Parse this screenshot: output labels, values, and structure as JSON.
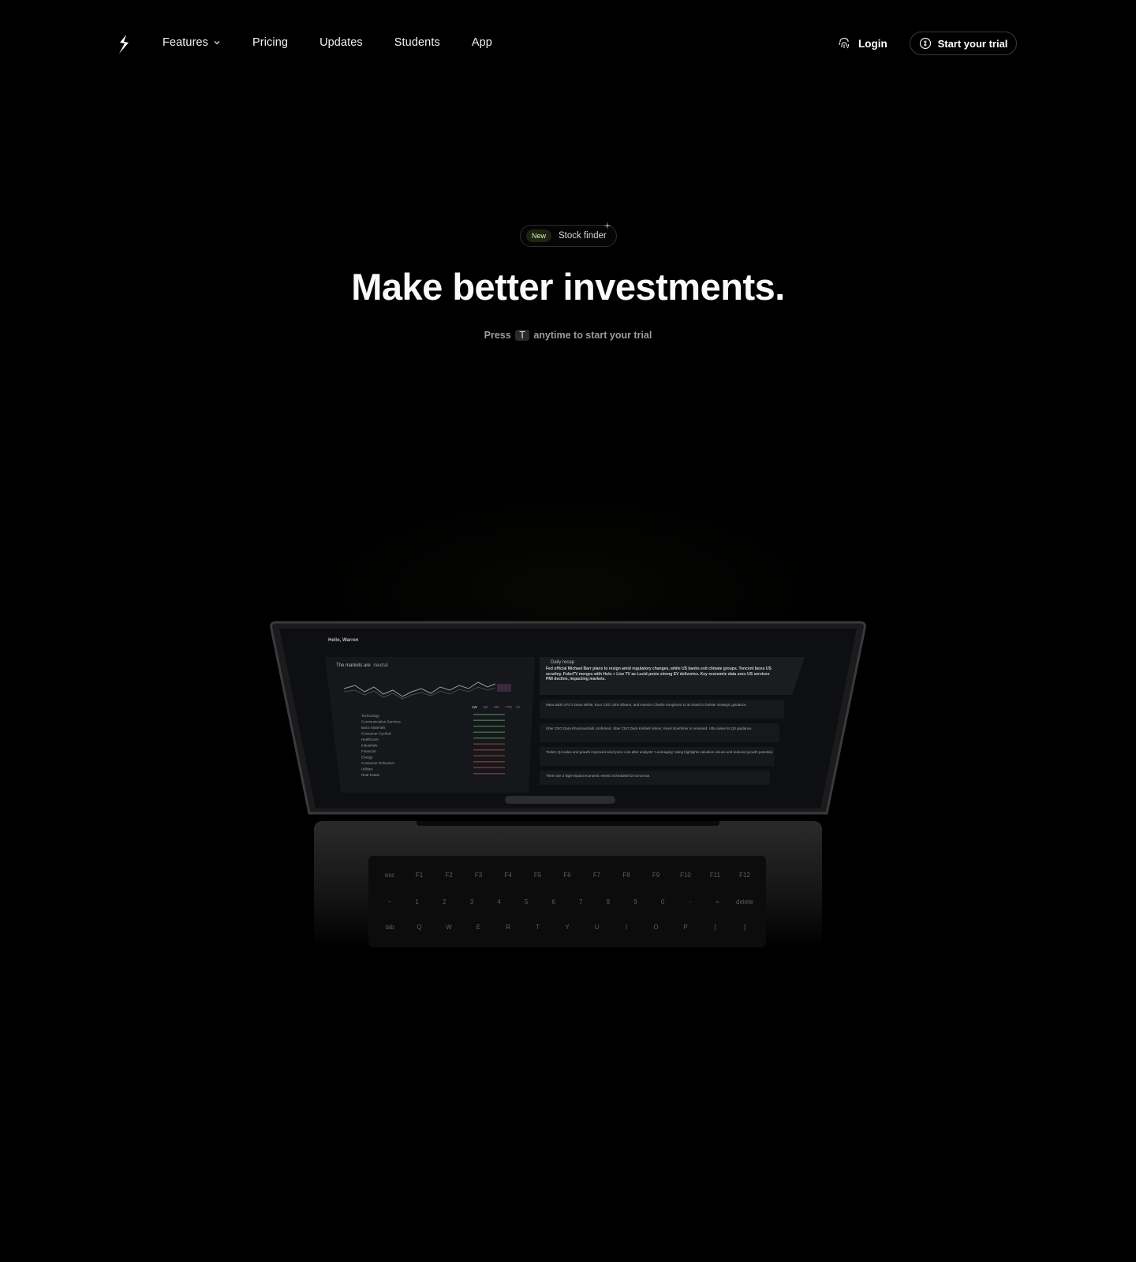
{
  "nav": {
    "links": [
      {
        "label": "Features",
        "dropdown": true
      },
      {
        "label": "Pricing"
      },
      {
        "label": "Updates"
      },
      {
        "label": "Students"
      },
      {
        "label": "App"
      }
    ],
    "login_label": "Login",
    "trial_label": "Start your trial"
  },
  "hero": {
    "badge": "New",
    "badge_label": "Stock finder",
    "headline": "Make better investments.",
    "sub_prefix": "Press",
    "sub_key": "T",
    "sub_suffix": "anytime to start your trial"
  },
  "app_preview": {
    "greeting": "Hello, Warren",
    "market_prefix": "The markets are",
    "market_state": "neutral",
    "recap_label": "Daily recap",
    "recap_text": "Fed official Michael Barr plans to resign amid regulatory changes, while US banks exit climate groups. Tencent faces US scrutiny. FuboTV merges with Hulu + Live TV as Lucid posts strong EV deliveries. Key economic data sees US services PMI decline, impacting markets.",
    "news": [
      "Meta adds UFC's Dana White, Exor CEO John Elkann, and investor Charlie Songhurst to its board to bolster strategic guidance.",
      "Uber CEO Dara Khosrowshahi confirmed. Uber CEO Dara Kimbell retires; Kevin Boehlmer is renamed. Ulta raises its Q4 guidance.",
      "Tesla's Q4 sales and growth improved amid price cuts after analysts' 'Leveraging' rating highlights valuation issues and reduced growth potential.",
      "There are 2 high-impact economic events scheduled for tomorrow."
    ],
    "sectors": [
      "Technology",
      "Communication Services",
      "Basic Materials",
      "Consumer Cyclical",
      "Healthcare",
      "Industrials",
      "Financial",
      "Energy",
      "Consumer Defensive",
      "Utilities",
      "Real Estate"
    ],
    "timeframes": [
      "1W",
      "1M",
      "3M",
      "YTD",
      "1Y"
    ]
  },
  "keyboard": {
    "fn_row": [
      "esc",
      "F1",
      "F2",
      "F3",
      "F4",
      "F5",
      "F6",
      "F7",
      "F8",
      "F9",
      "F10",
      "F11",
      "F12"
    ],
    "num_row": [
      "~",
      "1",
      "2",
      "3",
      "4",
      "5",
      "6",
      "7",
      "8",
      "9",
      "0",
      "-",
      "=",
      "delete"
    ],
    "top_row": [
      "tab",
      "Q",
      "W",
      "E",
      "R",
      "T",
      "Y",
      "U",
      "I",
      "O",
      "P",
      "[",
      "]"
    ]
  },
  "colors": {
    "background": "#000000",
    "badge_bg": "#1f2414",
    "badge_text": "#d9f0a0",
    "border": "#3a3a3a"
  }
}
